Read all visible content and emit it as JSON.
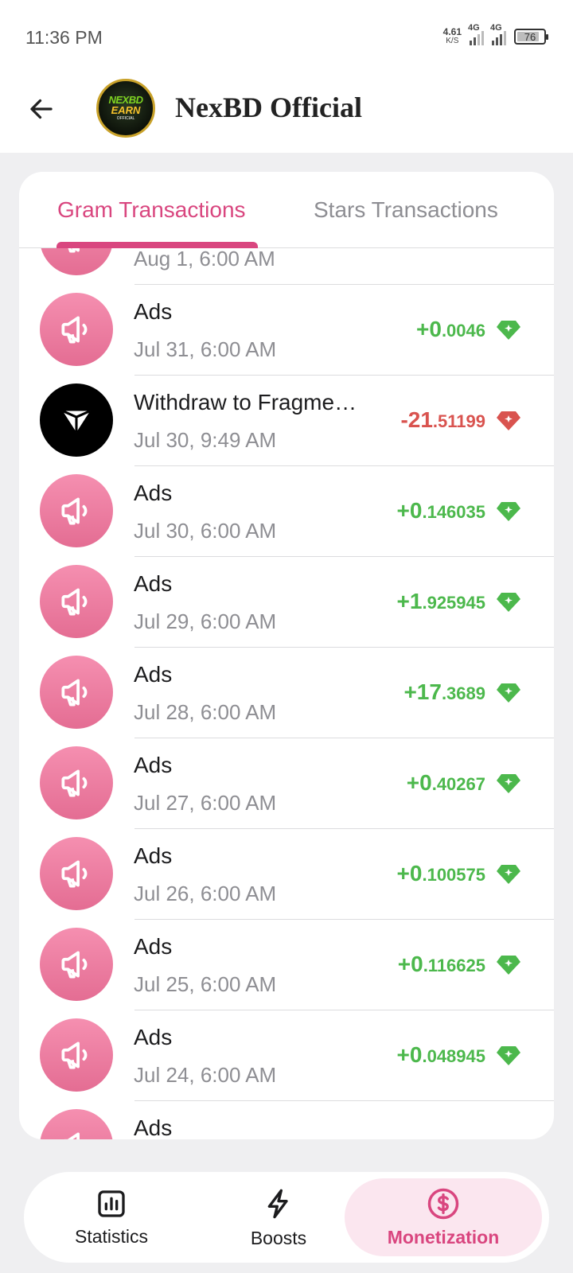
{
  "status_bar": {
    "time": "11:36 PM",
    "net_speed_value": "4.61",
    "net_speed_unit": "K/S",
    "sim1_label": "4G",
    "sim2_label": "4G",
    "battery": "76"
  },
  "header": {
    "title": "NexBD Official",
    "logo_line1": "NEXBD",
    "logo_line2": "EARN",
    "logo_line3": "OFFICIAL"
  },
  "tabs": {
    "gram": "Gram Transactions",
    "stars": "Stars Transactions",
    "active": "gram"
  },
  "transactions": [
    {
      "title": "",
      "date": "Aug 1, 6:00 AM",
      "amount_int": "",
      "amount_dec": "",
      "type": "ads",
      "sign": "pos"
    },
    {
      "title": "Ads",
      "date": "Jul 31, 6:00 AM",
      "amount_int": "+0",
      "amount_dec": ".0046",
      "type": "ads",
      "sign": "pos"
    },
    {
      "title": "Withdraw to Fragme…",
      "date": "Jul 30, 9:49 AM",
      "amount_int": "-21",
      "amount_dec": ".51199",
      "type": "fragment",
      "sign": "neg"
    },
    {
      "title": "Ads",
      "date": "Jul 30, 6:00 AM",
      "amount_int": "+0",
      "amount_dec": ".146035",
      "type": "ads",
      "sign": "pos"
    },
    {
      "title": "Ads",
      "date": "Jul 29, 6:00 AM",
      "amount_int": "+1",
      "amount_dec": ".925945",
      "type": "ads",
      "sign": "pos"
    },
    {
      "title": "Ads",
      "date": "Jul 28, 6:00 AM",
      "amount_int": "+17",
      "amount_dec": ".3689",
      "type": "ads",
      "sign": "pos"
    },
    {
      "title": "Ads",
      "date": "Jul 27, 6:00 AM",
      "amount_int": "+0",
      "amount_dec": ".40267",
      "type": "ads",
      "sign": "pos"
    },
    {
      "title": "Ads",
      "date": "Jul 26, 6:00 AM",
      "amount_int": "+0",
      "amount_dec": ".100575",
      "type": "ads",
      "sign": "pos"
    },
    {
      "title": "Ads",
      "date": "Jul 25, 6:00 AM",
      "amount_int": "+0",
      "amount_dec": ".116625",
      "type": "ads",
      "sign": "pos"
    },
    {
      "title": "Ads",
      "date": "Jul 24, 6:00 AM",
      "amount_int": "+0",
      "amount_dec": ".048945",
      "type": "ads",
      "sign": "pos"
    },
    {
      "title": "Ads",
      "date": "",
      "amount_int": "",
      "amount_dec": "",
      "type": "ads",
      "sign": "pos"
    }
  ],
  "bottom_nav": {
    "statistics": "Statistics",
    "boosts": "Boosts",
    "monetization": "Monetization",
    "active": "monetization"
  },
  "colors": {
    "accent": "#d9467f",
    "positive": "#4cb84c",
    "negative": "#d9534f",
    "ads_avatar": "#ee7fa3"
  },
  "icons": {
    "ads": "megaphone-icon",
    "fragment": "fragment-logo-icon",
    "amount": "gem-icon",
    "back": "arrow-left-icon",
    "statistics": "bar-chart-icon",
    "boosts": "lightning-icon",
    "monetization": "dollar-circle-icon"
  }
}
